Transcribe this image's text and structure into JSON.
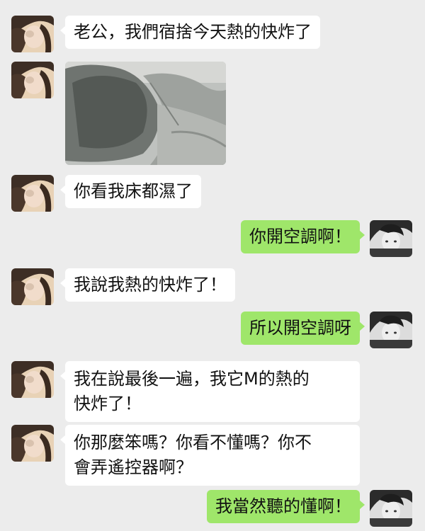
{
  "messages": [
    {
      "side": "left",
      "type": "text",
      "text": "老公，我們宿捨今天熱的快炸了"
    },
    {
      "side": "left",
      "type": "image"
    },
    {
      "side": "left",
      "type": "text",
      "text": "你看我床都濕了"
    },
    {
      "side": "right",
      "type": "text",
      "text": "你開空調啊！"
    },
    {
      "side": "left",
      "type": "text",
      "text": "我說我熱的快炸了！"
    },
    {
      "side": "right",
      "type": "text",
      "text": "所以開空調呀"
    },
    {
      "side": "left",
      "type": "text",
      "lines": [
        "我在說最後一遍，我它M的熱的",
        "快炸了！"
      ]
    },
    {
      "side": "left",
      "type": "text",
      "lines": [
        "你那麼笨嗎？你看不懂嗎？你不",
        "會弄遙控器啊？"
      ]
    },
    {
      "side": "right",
      "type": "text",
      "text": "我當然聽的懂啊！"
    }
  ],
  "colors": {
    "background": "#ececec",
    "incoming_bubble": "#ffffff",
    "outgoing_bubble": "#9fe66a"
  },
  "icons": {
    "incoming_avatar": "girl-avatar",
    "outgoing_avatar": "boy-avatar"
  }
}
